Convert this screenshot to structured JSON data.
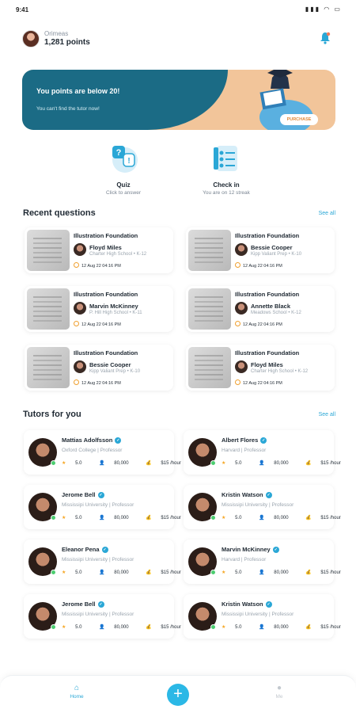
{
  "status": {
    "time": "9:41",
    "icons": "▮▮▮ ◠ ▭"
  },
  "profile": {
    "name": "Orimeas",
    "points": "1,281 points"
  },
  "banner": {
    "title": "You points are below 20!",
    "subtitle": "You can't find the tutor now!",
    "button": "PURCHASE"
  },
  "quick_actions": [
    {
      "title": "Quiz",
      "subtitle": "Click to answer"
    },
    {
      "title": "Check in",
      "subtitle": "You are on 12 streak"
    }
  ],
  "recent": {
    "title": "Recent questions",
    "see_all": "See all",
    "items": [
      {
        "topic": "Illustration Foundation",
        "name": "Floyd Miles",
        "school": "Charter High School  •  K-12",
        "date": "12 Aug 22 04:16 PM"
      },
      {
        "topic": "Illustration Foundation",
        "name": "Bessie Cooper",
        "school": "Kipp Valiant Prep  •  K-10",
        "date": "12 Aug 22 04:16 PM"
      },
      {
        "topic": "Illustration Foundation",
        "name": "Marvin McKinney",
        "school": "P. Hill High School  •  K-11",
        "date": "12 Aug 22 04:16 PM"
      },
      {
        "topic": "Illustration Foundation",
        "name": "Annette Black",
        "school": "Meadows School  •  K-12",
        "date": "12 Aug 22 04:16 PM"
      },
      {
        "topic": "Illustration Foundation",
        "name": "Bessie Cooper",
        "school": "Kipp Valiant Prep  •  K-10",
        "date": "12 Aug 22 04:16 PM"
      },
      {
        "topic": "Illustration Foundation",
        "name": "Floyd Miles",
        "school": "Charter High School  •  K-12",
        "date": "12 Aug 22 04:16 PM"
      }
    ]
  },
  "tutors": {
    "title": "Tutors for you",
    "see_all": "See all",
    "items": [
      {
        "name": "Mattias Adolfsson",
        "school": "Oxford College  |  Professor",
        "rating": "5.0",
        "students": "80,000",
        "price": "$15 /hour"
      },
      {
        "name": "Albert Flores",
        "school": "Harvard  |  Professor",
        "rating": "5.0",
        "students": "80,000",
        "price": "$15 /hour"
      },
      {
        "name": "Jerome Bell",
        "school": "Mississipi University  |  Professor",
        "rating": "5.0",
        "students": "80,000",
        "price": "$15 /hour"
      },
      {
        "name": "Kristin Watson",
        "school": "Mississipi University  |  Professor",
        "rating": "5.0",
        "students": "80,000",
        "price": "$15 /hour"
      },
      {
        "name": "Eleanor Pena",
        "school": "Mississipi University  |  Professor",
        "rating": "5.0",
        "students": "80,000",
        "price": "$15 /hour"
      },
      {
        "name": "Marvin McKinney",
        "school": "Harvard  |  Professor",
        "rating": "5.0",
        "students": "80,000",
        "price": "$15 /hour"
      },
      {
        "name": "Jerome Bell",
        "school": "Mississipi University  |  Professor",
        "rating": "5.0",
        "students": "80,000",
        "price": "$15 /hour"
      },
      {
        "name": "Kristin Watson",
        "school": "Mississipi University  |  Professor",
        "rating": "5.0",
        "students": "80,000",
        "price": "$15 /hour"
      }
    ]
  },
  "nav": {
    "home": "Home",
    "me": "Me",
    "add": "+"
  },
  "colors": {
    "accent": "#2aa7d6",
    "banner_teal": "#1b6b85",
    "banner_peach": "#f2c59a",
    "star": "#f5a623",
    "online": "#4ccd70"
  },
  "icons": {
    "notify": "notification-icon",
    "quiz": "quiz-icon",
    "checkin": "checkin-icon",
    "home": "home-icon",
    "me": "user-icon"
  }
}
